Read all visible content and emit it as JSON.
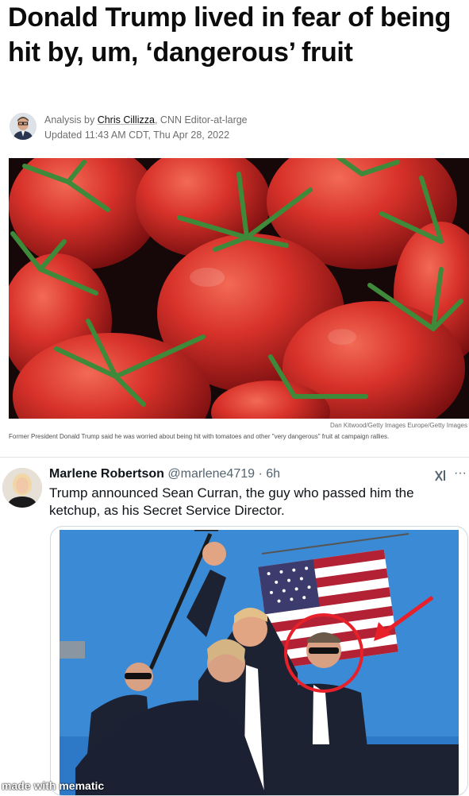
{
  "article": {
    "headline": "Donald Trump lived in fear of being hit by, um, ‘dangerous’ fruit",
    "byline_prefix": "Analysis by ",
    "author": "Chris Cillizza",
    "author_role": ", CNN Editor-at-large",
    "updated": "Updated 11:43 AM CDT, Thu Apr 28, 2022",
    "photo_credit": "Dan Kitwood/Getty Images Europe/Getty Images",
    "caption": "Former President Donald Trump said he was worried about being hit with tomatoes and other \"very dangerous\" fruit at campaign rallies."
  },
  "tweet": {
    "name": "Marlene Robertson",
    "handle": "@marlene4719",
    "separator": " · ",
    "time": "6h",
    "text": "Trump announced Sean Curran, the guy who passed him the ketchup, as his Secret Service Director.",
    "more_glyph": "···",
    "icons": [
      "grok-icon",
      "more-icon"
    ]
  },
  "watermark": "made with mematic",
  "colors": {
    "headline": "#0c0c0c",
    "meta": "#6e6e6e",
    "handle": "#536471",
    "tomato": "#d8322a",
    "sky": "#3b8ad6",
    "annotation": "#e8202a"
  }
}
